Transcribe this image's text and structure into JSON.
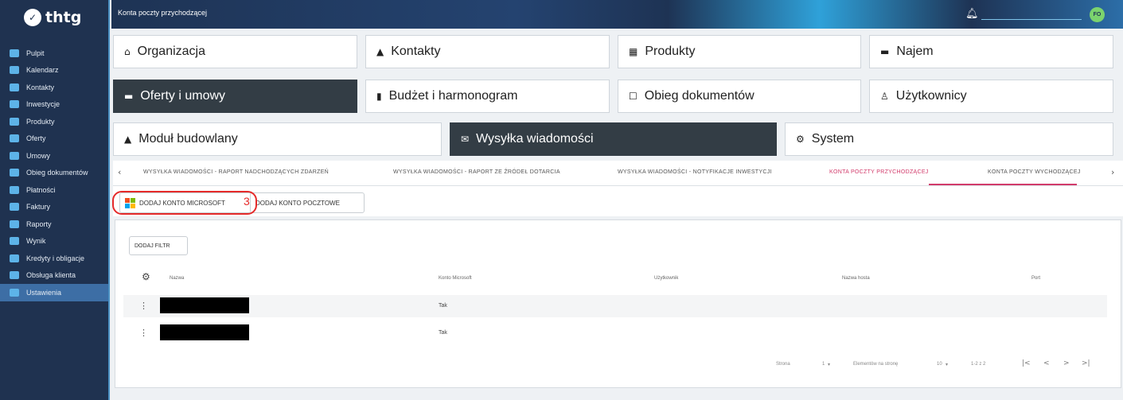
{
  "app": {
    "logo_text": "thtg",
    "page_title": "Konta poczty przychodzącej",
    "avatar_initials": "FO"
  },
  "sidebar": {
    "items": [
      {
        "label": "Pulpit"
      },
      {
        "label": "Kalendarz"
      },
      {
        "label": "Kontakty"
      },
      {
        "label": "Inwestycje"
      },
      {
        "label": "Produkty"
      },
      {
        "label": "Oferty"
      },
      {
        "label": "Umowy"
      },
      {
        "label": "Obieg dokumentów"
      },
      {
        "label": "Płatności"
      },
      {
        "label": "Faktury"
      },
      {
        "label": "Raporty"
      },
      {
        "label": "Wynik"
      },
      {
        "label": "Kredyty i obligacje"
      },
      {
        "label": "Obsługa klienta"
      },
      {
        "label": "Ustawienia"
      }
    ],
    "active_item": "Ustawienia"
  },
  "modules": {
    "row1": [
      {
        "label": "Organizacja",
        "icon": "home-icon"
      },
      {
        "label": "Kontakty",
        "icon": "person-icon"
      },
      {
        "label": "Produkty",
        "icon": "store-icon"
      },
      {
        "label": "Najem",
        "icon": "car-icon"
      }
    ],
    "row2": [
      {
        "label": "Oferty i umowy",
        "icon": "folder-icon"
      },
      {
        "label": "Budżet i harmonogram",
        "icon": "budget-icon"
      },
      {
        "label": "Obieg dokumentów",
        "icon": "document-icon"
      },
      {
        "label": "Użytkownicy",
        "icon": "user-icon"
      }
    ],
    "row3": [
      {
        "label": "Moduł budowlany",
        "icon": "warning-icon"
      },
      {
        "label": "Wysyłka wiadomości",
        "icon": "mail-icon"
      },
      {
        "label": "System",
        "icon": "gear-icon"
      }
    ],
    "selected": [
      "Oferty i umowy",
      "Wysyłka wiadomości"
    ]
  },
  "tabs": [
    {
      "label": "WYSYŁKA WIADOMOŚCI - RAPORT NADCHODZĄCYCH ZDARZEŃ"
    },
    {
      "label": "WYSYŁKA WIADOMOŚCI - RAPORT ZE ŹRÓDEŁ DOTARCIA"
    },
    {
      "label": "WYSYŁKA WIADOMOŚCI - NOTYFIKACJE INWESTYCJI"
    },
    {
      "label": "KONTA POCZTY PRZYCHODZĄCEJ"
    },
    {
      "label": "KONTA POCZTY WYCHODZĄCEJ"
    }
  ],
  "active_tab": "KONTA POCZTY PRZYCHODZĄCEJ",
  "actions": {
    "add_microsoft": "DODAJ KONTO MICROSOFT",
    "add_mail": "DODAJ KONTO POCZTOWE",
    "callout_number": "3",
    "callout_color": "#e52a2a"
  },
  "filter": {
    "add_filter": "DODAJ FILTR"
  },
  "table": {
    "columns": [
      "Nazwa",
      "Konto Microsoft",
      "Użytkownik",
      "Nazwa hosta",
      "Port"
    ],
    "rows": [
      {
        "name": "",
        "microsoft": "Tak",
        "user": "",
        "host": "",
        "port": ""
      },
      {
        "name": "",
        "microsoft": "Tak",
        "user": "",
        "host": "",
        "port": ""
      }
    ]
  },
  "pagination": {
    "page_label": "Strona",
    "page_value": "1",
    "per_page_label": "Elementów na stronę",
    "per_page_value": "10",
    "range": "1-2 z 2"
  },
  "colors": {
    "accent": "#d23b6b",
    "sidebar": "#1f3250",
    "dark_tile": "#333d45"
  }
}
